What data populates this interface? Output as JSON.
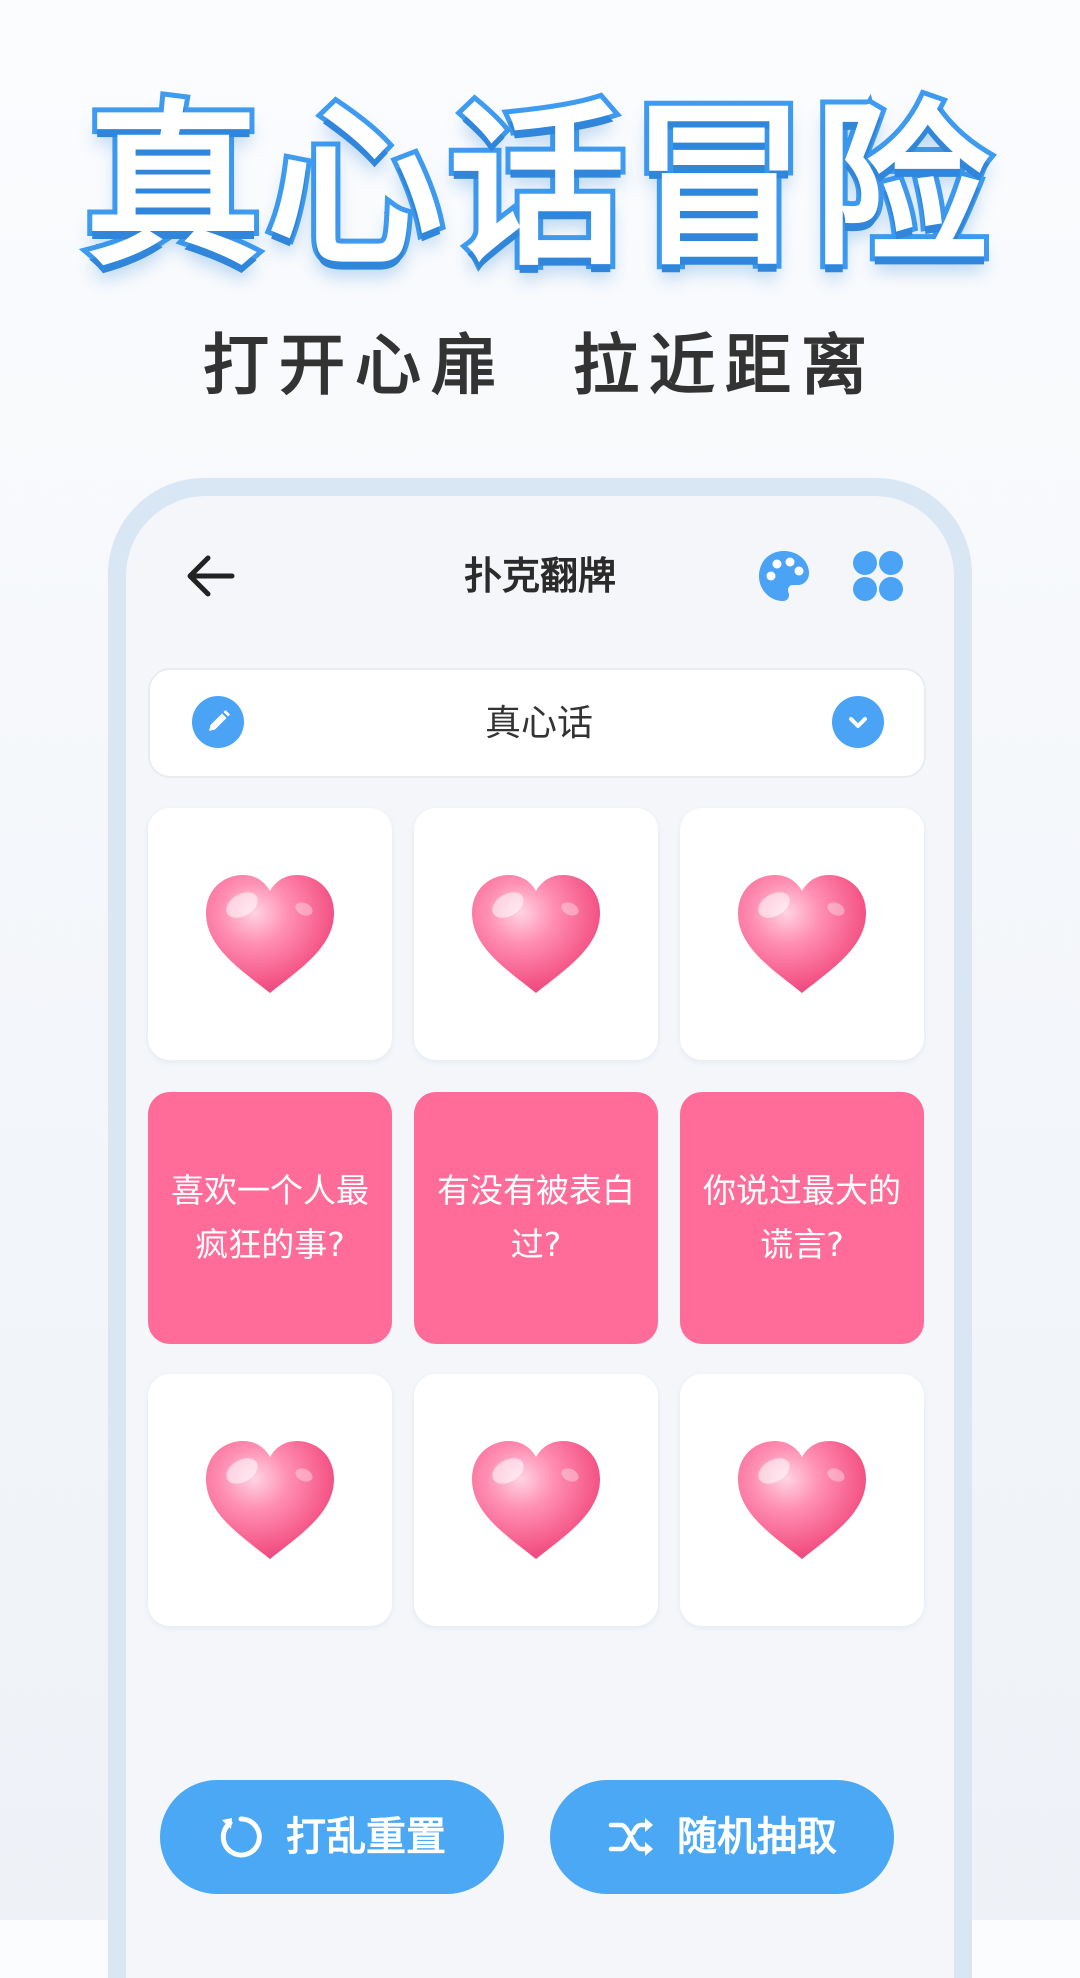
{
  "promo": {
    "title": "真心话冒险",
    "subtitle": "打开心扉  拉近距离"
  },
  "app_bar": {
    "title": "扑克翻牌",
    "back_icon": "arrow-left-icon",
    "palette_icon": "palette-icon",
    "grid_icon": "grid-icon"
  },
  "category": {
    "label": "真心话",
    "edit_icon": "pencil-icon",
    "dropdown_icon": "chevron-down-icon"
  },
  "cards": [
    {
      "state": "face-down",
      "text": ""
    },
    {
      "state": "face-down",
      "text": ""
    },
    {
      "state": "face-down",
      "text": ""
    },
    {
      "state": "face-up",
      "text": "喜欢一个人最疯狂的事?"
    },
    {
      "state": "face-up",
      "text": "有没有被表白过?"
    },
    {
      "state": "face-up",
      "text": "你说过最大的谎言?"
    },
    {
      "state": "face-down",
      "text": ""
    },
    {
      "state": "face-down",
      "text": ""
    },
    {
      "state": "face-down",
      "text": ""
    }
  ],
  "actions": {
    "shuffle_label": "打乱重置",
    "random_label": "随机抽取",
    "shuffle_icon": "refresh-icon",
    "random_icon": "shuffle-icon"
  },
  "colors": {
    "accent_blue": "#4aa8f5",
    "card_pink": "#ff6c99",
    "title_outline": "#3f9cf0"
  }
}
